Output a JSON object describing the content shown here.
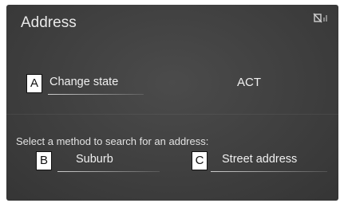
{
  "header": {
    "title": "Address",
    "status_icon": "no-signal-icon"
  },
  "state_row": {
    "badge": "A",
    "button_label": "Change state",
    "current_value": "ACT"
  },
  "instruction": "Select a method to search for an address:",
  "search_methods": [
    {
      "badge": "B",
      "label": "Suburb"
    },
    {
      "badge": "C",
      "label": "Street address"
    }
  ]
}
